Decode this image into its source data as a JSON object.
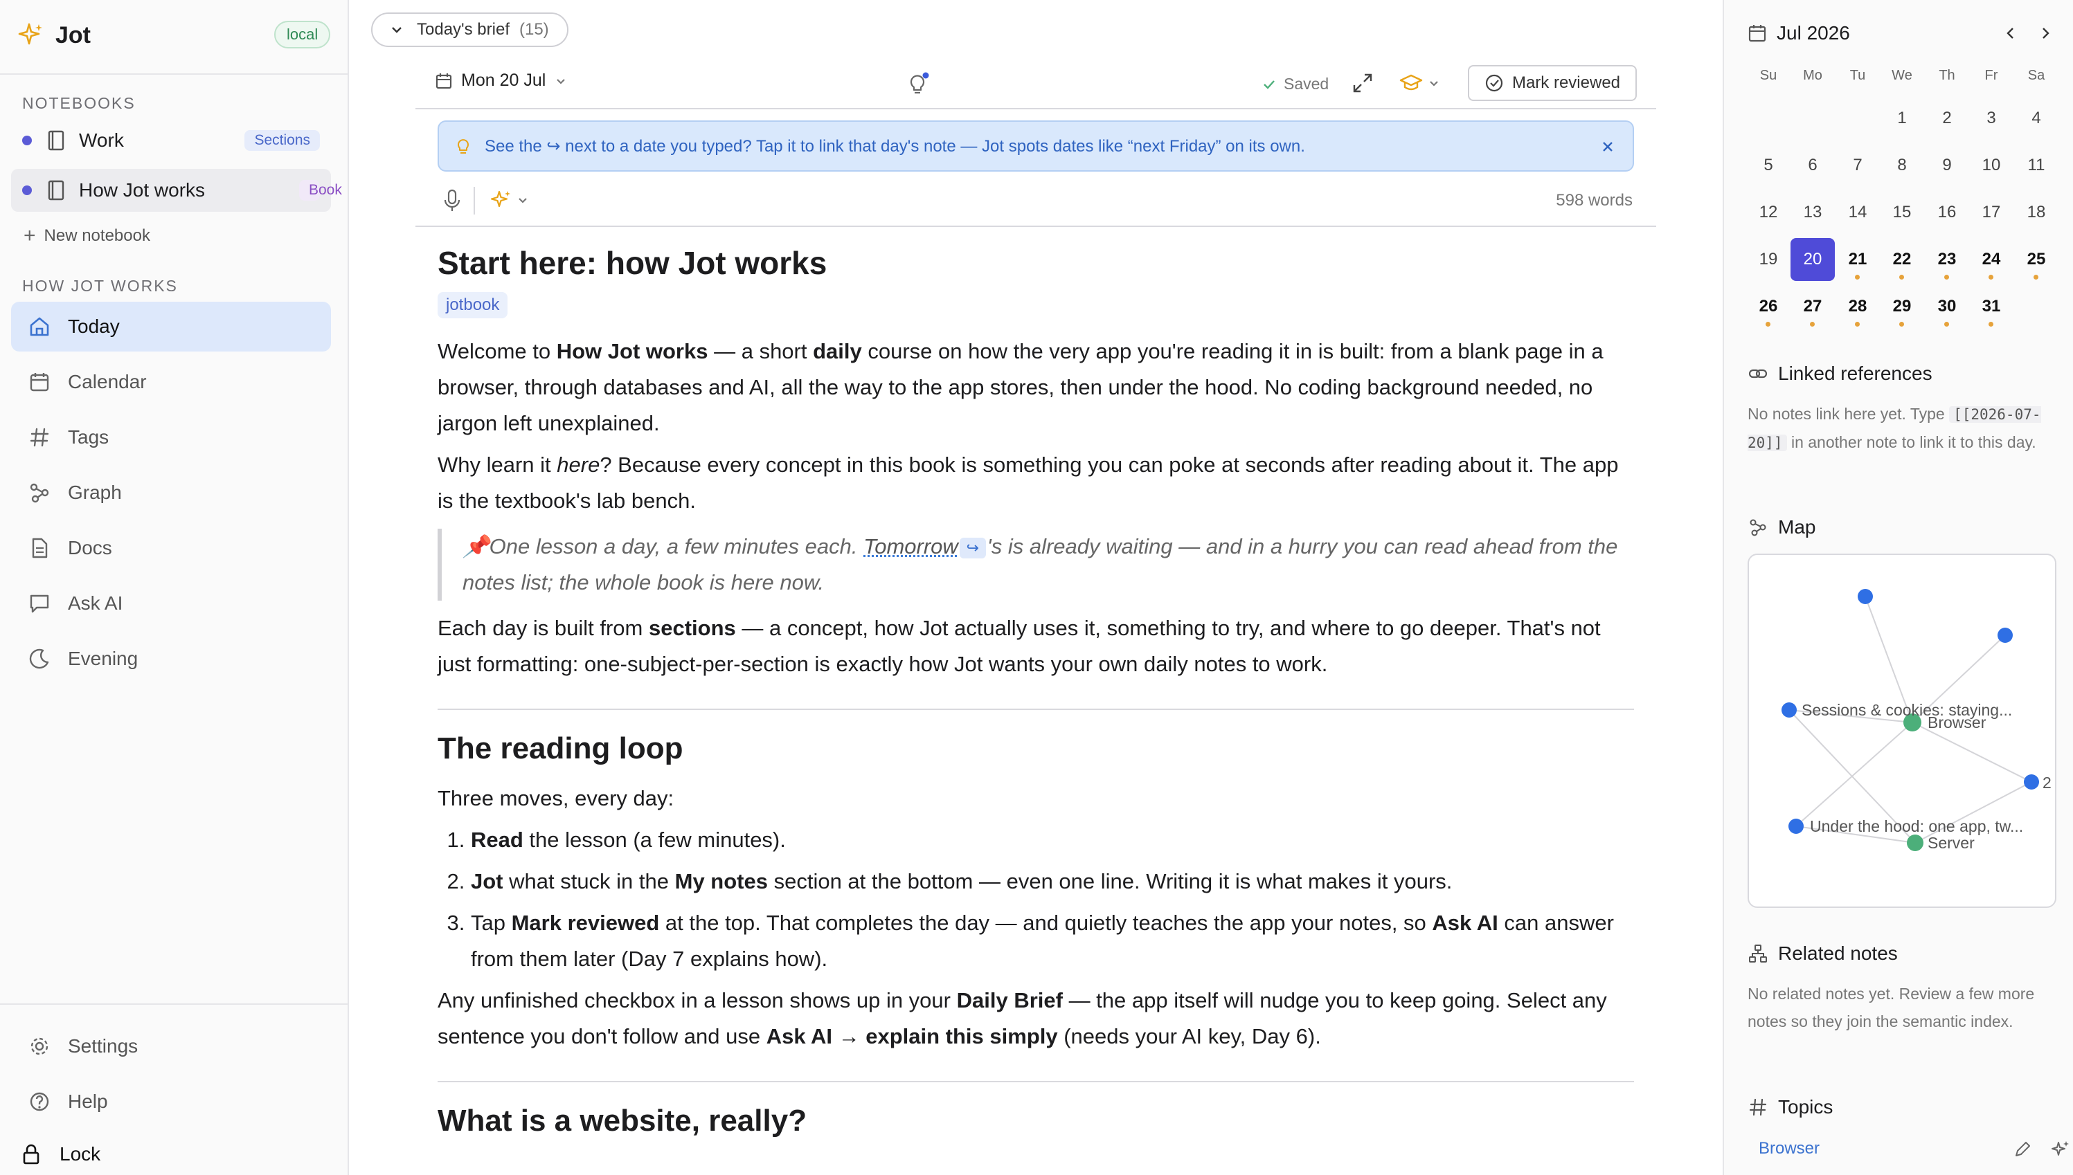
{
  "sidebar": {
    "app_name": "Jot",
    "storage_badge": "local",
    "notebooks_heading": "NOTEBOOKS",
    "notebooks": [
      {
        "label": "Work",
        "tag": "Sections"
      },
      {
        "label": "How Jot works",
        "tag": "Book"
      }
    ],
    "new_notebook": "New notebook",
    "section_heading": "HOW JOT WORKS",
    "nav": [
      {
        "label": "Today",
        "icon": "home-icon"
      },
      {
        "label": "Calendar",
        "icon": "calendar-icon"
      },
      {
        "label": "Tags",
        "icon": "hash-icon"
      },
      {
        "label": "Graph",
        "icon": "graph-icon"
      },
      {
        "label": "Docs",
        "icon": "doc-icon"
      },
      {
        "label": "Ask AI",
        "icon": "chat-icon"
      },
      {
        "label": "Evening",
        "icon": "moon-icon"
      }
    ],
    "footer": [
      {
        "label": "Settings",
        "icon": "gear-icon"
      },
      {
        "label": "Help",
        "icon": "help-icon"
      },
      {
        "label": "Lock",
        "icon": "lock-icon"
      }
    ]
  },
  "main": {
    "brief_label": "Today's brief",
    "brief_count": "(15)",
    "date_label": "Mon 20 Jul",
    "saved_label": "Saved",
    "mark_reviewed": "Mark reviewed",
    "tip_text": "See the ↪ next to a date you typed? Tap it to link that day's note — Jot spots dates like “next Friday” on its own.",
    "word_count": "598 words",
    "doc": {
      "title": "Start here: how Jot works",
      "tag": "jotbook",
      "p1": {
        "a": "Welcome to ",
        "b": "How Jot works",
        "c": " — a short ",
        "d": "daily",
        "e": " course on how the very app you're reading it in is built: from a blank page in a browser, through databases and AI, all the way to the app stores, then under the hood. No coding background needed, no jargon left unexplained."
      },
      "p2": {
        "a": "Why learn it ",
        "b": "here",
        "c": "? Because every concept in this book is something you can poke at seconds after reading about it. The app is the textbook's lab bench."
      },
      "callout": {
        "pin": "📌",
        "a": "One lesson a day, a few minutes each. ",
        "link": "Tomorrow",
        "chip": "↪",
        "b": "'s is already waiting — and in a hurry you can read ahead from the notes list; the whole book is here now."
      },
      "p3": {
        "a": "Each day is built from ",
        "b": "sections",
        "c": " — a concept, how Jot actually uses it, something to try, and where to go deeper. That's not just formatting: one-subject-per-section is exactly how Jot wants your own daily notes to work."
      },
      "h2a": "The reading loop",
      "p4": "Three moves, every day:",
      "list": [
        {
          "b": "Read",
          "t": " the lesson (a few minutes)."
        },
        {
          "b": "Jot",
          "t": " what stuck in the ",
          "b2": "My notes",
          "t2": " section at the bottom — even one line. Writing it is what makes it yours."
        },
        {
          "pre": "Tap ",
          "b": "Mark reviewed",
          "t": " at the top. That completes the day — and quietly teaches the app your notes, so ",
          "b2": "Ask AI",
          "t2": " can answer from them later (Day 7 explains how)."
        }
      ],
      "p5": {
        "a": "Any unfinished checkbox in a lesson shows up in your ",
        "b": "Daily Brief",
        "c": " — the app itself will nudge you to keep going. Select any sentence you don't follow and use ",
        "d": "Ask AI → explain this simply",
        "e": " (needs your AI key, Day 6)."
      },
      "h2b": "What is a website, really?"
    }
  },
  "right": {
    "month": "Jul 2026",
    "weekdays": [
      "Su",
      "Mo",
      "Tu",
      "We",
      "Th",
      "Fr",
      "Sa"
    ],
    "days_in_month": 31,
    "first_weekday": 3,
    "selected_day": 20,
    "future_days_with_notes": [
      21,
      22,
      23,
      24,
      25,
      26,
      27,
      28,
      29,
      30,
      31
    ],
    "linked_refs_title": "Linked references",
    "linked_refs_text_a": "No notes link here yet. Type ",
    "linked_refs_code": "[[2026-07-20]]",
    "linked_refs_text_b": " in another note to link it to this day.",
    "map_title": "Map",
    "map_labels": {
      "sessions": "Sessions & cookies: staying...",
      "browser": "Browser",
      "hood": "Under the hood: one app, tw...",
      "server": "Server",
      "two": "2"
    },
    "related_title": "Related notes",
    "related_text": "No related notes yet. Review a few more notes so they join the semantic index.",
    "topics_title": "Topics",
    "topic": "Browser",
    "colors": {
      "accent": "#4f4bd8",
      "link": "#3b72cf",
      "map_blue": "#2f6fe4",
      "map_green": "#4caf7a",
      "note_dot": "#e6a23a"
    }
  }
}
